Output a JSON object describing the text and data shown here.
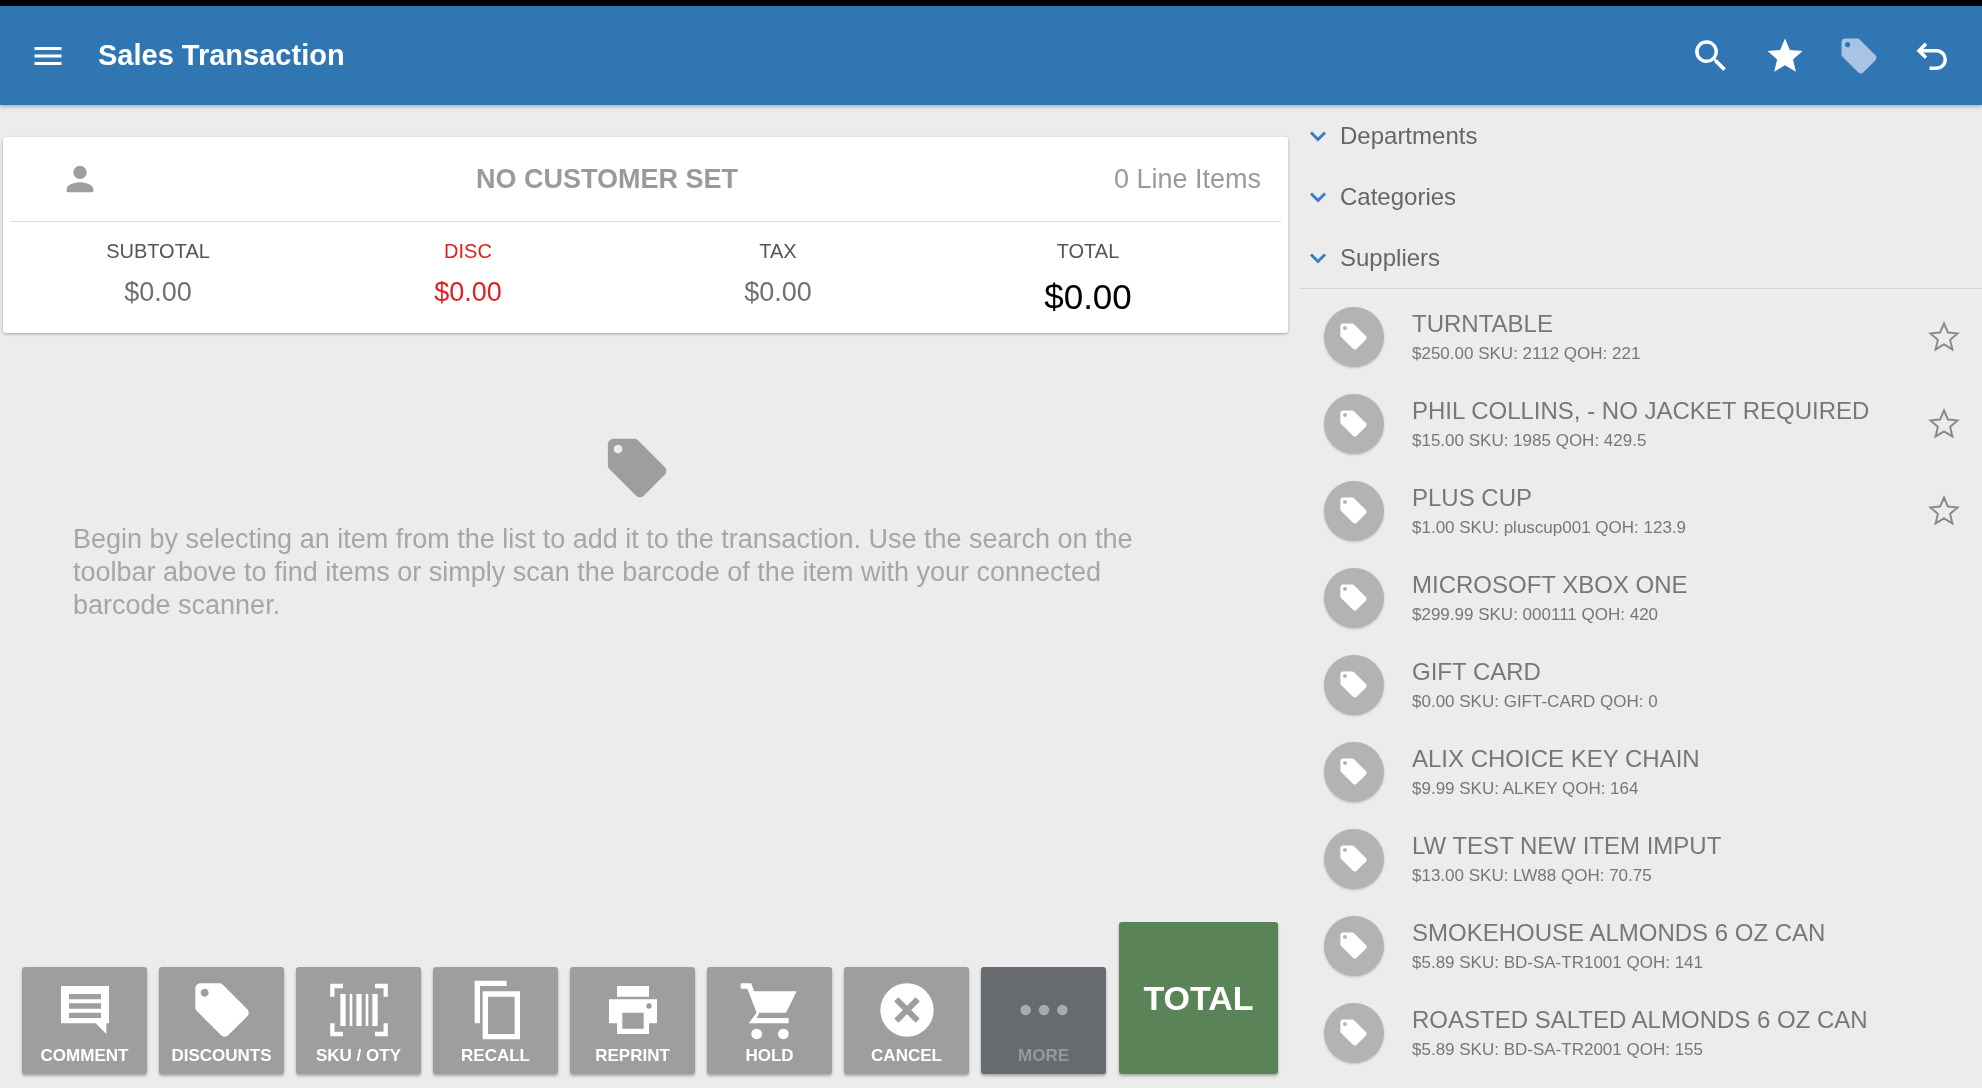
{
  "app_bar": {
    "title": "Sales Transaction"
  },
  "summary": {
    "customer": "NO CUSTOMER SET",
    "line_items": "0 Line Items",
    "totals": [
      {
        "label": "SUBTOTAL",
        "value": "$0.00",
        "kind": "plain"
      },
      {
        "label": "DISC",
        "value": "$0.00",
        "kind": "discount"
      },
      {
        "label": "TAX",
        "value": "$0.00",
        "kind": "plain"
      },
      {
        "label": "TOTAL",
        "value": "$0.00",
        "kind": "grand"
      }
    ]
  },
  "empty_message": "Begin by selecting an item from the list to add it to the transaction. Use the search on the toolbar above to find items or simply scan the barcode of the item with your connected barcode scanner.",
  "actions": [
    {
      "label": "COMMENT",
      "kind": "comment",
      "disabled": false
    },
    {
      "label": "DISCOUNTS",
      "kind": "tag",
      "disabled": false
    },
    {
      "label": "SKU / OTY",
      "kind": "barcode",
      "disabled": false
    },
    {
      "label": "RECALL",
      "kind": "copy",
      "disabled": false
    },
    {
      "label": "REPRINT",
      "kind": "print",
      "disabled": false
    },
    {
      "label": "HOLD",
      "kind": "cart",
      "disabled": false
    },
    {
      "label": "CANCEL",
      "kind": "cancel",
      "disabled": false
    },
    {
      "label": "MORE",
      "kind": "more",
      "disabled": true
    }
  ],
  "total_button": "TOTAL",
  "groups": [
    {
      "label": "Departments",
      "expanded": false
    },
    {
      "label": "Categories",
      "expanded": false
    },
    {
      "label": "Suppliers",
      "expanded": false
    }
  ],
  "items": [
    {
      "name": "TURNTABLE",
      "details": "$250.00 SKU: 2112 QOH: 221",
      "starred": true
    },
    {
      "name": "PHIL COLLINS, - NO JACKET REQUIRED",
      "details": "$15.00 SKU: 1985 QOH: 429.5",
      "starred": true
    },
    {
      "name": "PLUS CUP",
      "details": "$1.00 SKU: pluscup001 QOH: 123.9",
      "starred": true
    },
    {
      "name": "MICROSOFT XBOX ONE",
      "details": "$299.99 SKU: 000111 QOH: 420",
      "starred": false
    },
    {
      "name": "GIFT CARD",
      "details": "$0.00 SKU: GIFT-CARD QOH: 0",
      "starred": false
    },
    {
      "name": "ALIX CHOICE KEY CHAIN",
      "details": "$9.99 SKU: ALKEY QOH: 164",
      "starred": false
    },
    {
      "name": "LW TEST NEW ITEM IMPUT",
      "details": "$13.00 SKU: LW88 QOH: 70.75",
      "starred": false
    },
    {
      "name": "SMOKEHOUSE ALMONDS 6 OZ CAN",
      "details": "$5.89 SKU: BD-SA-TR1001 QOH: 141",
      "starred": false
    },
    {
      "name": "ROASTED SALTED ALMONDS 6 OZ CAN",
      "details": "$5.89 SKU: BD-SA-TR2001 QOH: 155",
      "starred": false
    }
  ]
}
